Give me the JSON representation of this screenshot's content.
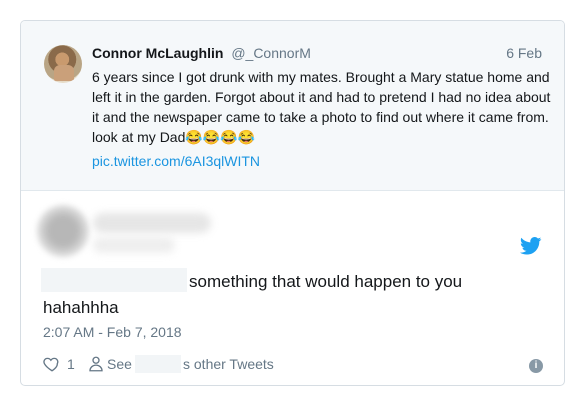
{
  "quoted_tweet": {
    "author_name": "Connor McLaughlin",
    "author_handle": "@_ConnorM",
    "date": "6 Feb",
    "text": "6 years since I got drunk with my mates. Brought a Mary statue home and left it in the garden. Forgot about it and had to pretend I had no idea about it and the newspaper came to take a photo to find out where it came from. look at my Dad😂😂😂😂",
    "link": "pic.twitter.com/6AI3qlWITN"
  },
  "main_tweet": {
    "text_line1": "something that would happen to you",
    "text_line2": "hahahhha",
    "timestamp": "2:07 AM - Feb 7, 2018"
  },
  "actions": {
    "like_count": "1",
    "see_prefix": "See",
    "see_suffix": "s other Tweets"
  },
  "colors": {
    "text_primary": "#14171a",
    "text_secondary": "#657786",
    "link": "#1b95e0",
    "quoted_background": "#f5f8fa"
  },
  "icons": {
    "twitter": "twitter-bird-icon",
    "like": "heart-icon",
    "profile": "person-icon",
    "info": "info-icon"
  }
}
